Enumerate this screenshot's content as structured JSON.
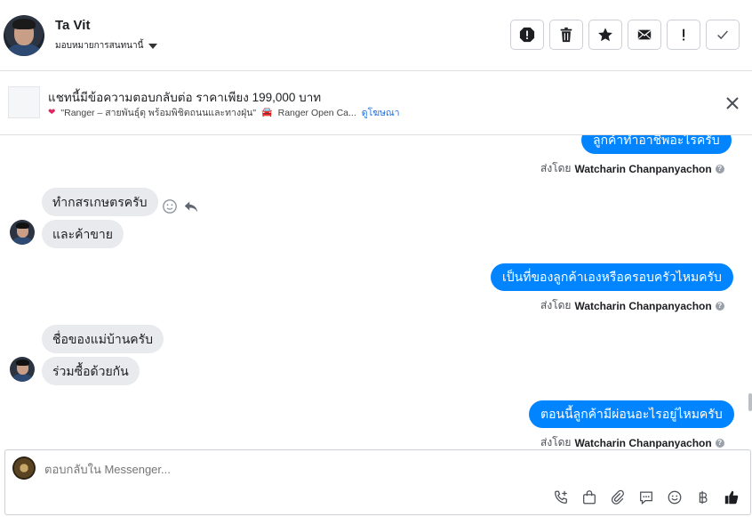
{
  "header": {
    "contact_name": "Ta Vit",
    "subtitle": "มอบหมายการสนทนานี้",
    "actions": [
      {
        "name": "spam-icon",
        "label": "report"
      },
      {
        "name": "trash-icon",
        "label": "delete"
      },
      {
        "name": "star-icon",
        "label": "star"
      },
      {
        "name": "envelope-icon",
        "label": "mark unread"
      },
      {
        "name": "exclamation-icon",
        "label": "important"
      },
      {
        "name": "check-icon",
        "label": "done"
      }
    ]
  },
  "ad": {
    "title": "แชทนี้มีข้อความตอบกลับต่อ ราคาเพียง 199,000 บาท",
    "detail_1": "\"Ranger – สายพันธุ์ดุ พร้อมพิชิตถนนและทางฝุ่น\"",
    "detail_2": "Ranger Open Ca...",
    "view_ad_link": "ดูโฆษณา"
  },
  "conversation": {
    "messages": [
      {
        "direction": "out",
        "text": "ลูกค้าทำอาชีพอะไรครับ"
      },
      {
        "direction": "in",
        "text": "ทำกสรเกษตรครับ"
      },
      {
        "direction": "in",
        "text": "และค้าขาย"
      },
      {
        "direction": "out",
        "text": "เป็นที่ของลูกค้าเองหรือครอบครัวไหมครับ"
      },
      {
        "direction": "in",
        "text": "ชื่อของแม่บ้านครับ"
      },
      {
        "direction": "in",
        "text": "ร่วมซื้อด้วยกัน"
      },
      {
        "direction": "out",
        "text": "ตอนนี้ลูกค้ามีผ่อนอะไรอยู่ไหมครับ"
      }
    ],
    "sent_by_label": "ส่งโดย",
    "sent_by_name": "Watcharin Chanpanyachon"
  },
  "composer": {
    "placeholder": "ตอบกลับใน Messenger...",
    "tools": [
      "phone-add-icon",
      "shopping-bag-icon",
      "paperclip-icon",
      "saved-reply-icon",
      "emoji-icon",
      "baht-icon",
      "like-icon"
    ]
  },
  "colors": {
    "outgoing_bubble": "#0084ff",
    "incoming_bubble": "#e9eaed",
    "link": "#216fdb"
  }
}
